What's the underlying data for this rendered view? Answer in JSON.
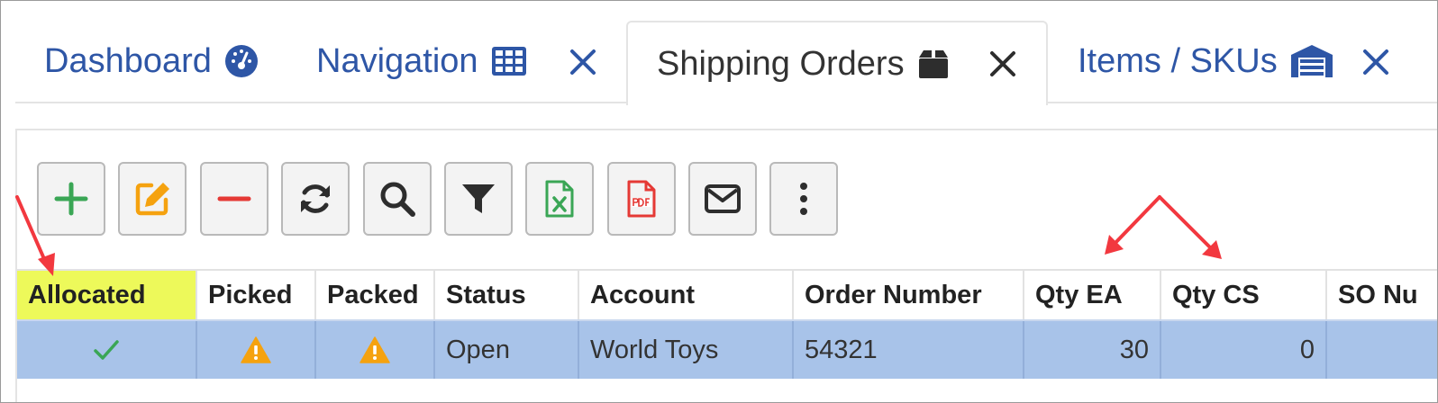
{
  "tabs": [
    {
      "label": "Dashboard",
      "icon": "dashboard-gauge-icon"
    },
    {
      "label": "Navigation",
      "icon": "grid-table-icon"
    },
    {
      "label": "Shipping Orders",
      "icon": "box-icon",
      "active": true
    },
    {
      "label": "Items / SKUs",
      "icon": "warehouse-icon"
    }
  ],
  "toolbar": [
    {
      "name": "add-button",
      "icon": "plus-icon"
    },
    {
      "name": "edit-button",
      "icon": "edit-icon"
    },
    {
      "name": "delete-button",
      "icon": "minus-icon"
    },
    {
      "name": "refresh-button",
      "icon": "refresh-icon"
    },
    {
      "name": "search-button",
      "icon": "search-icon"
    },
    {
      "name": "filter-button",
      "icon": "filter-icon"
    },
    {
      "name": "excel-export-button",
      "icon": "excel-file-icon"
    },
    {
      "name": "pdf-export-button",
      "icon": "pdf-file-icon"
    },
    {
      "name": "email-button",
      "icon": "envelope-icon"
    },
    {
      "name": "more-button",
      "icon": "more-vertical-icon"
    }
  ],
  "grid": {
    "columns": [
      "Allocated",
      "Picked",
      "Packed",
      "Status",
      "Account",
      "Order Number",
      "Qty EA",
      "Qty CS",
      "SO Nu"
    ],
    "rows": [
      {
        "allocated": "check",
        "picked": "warning",
        "packed": "warning",
        "status": "Open",
        "account": "World Toys",
        "order_number": "54321",
        "qty_ea": "30",
        "qty_cs": "0",
        "so_number": ""
      }
    ]
  },
  "colors": {
    "tab_text": "#2e56a6",
    "highlight": "#edf95a",
    "selected_row": "#a8c3e9",
    "annotation_arrow": "#f2383f",
    "warning": "#f5a20f",
    "check": "#3aa655"
  }
}
